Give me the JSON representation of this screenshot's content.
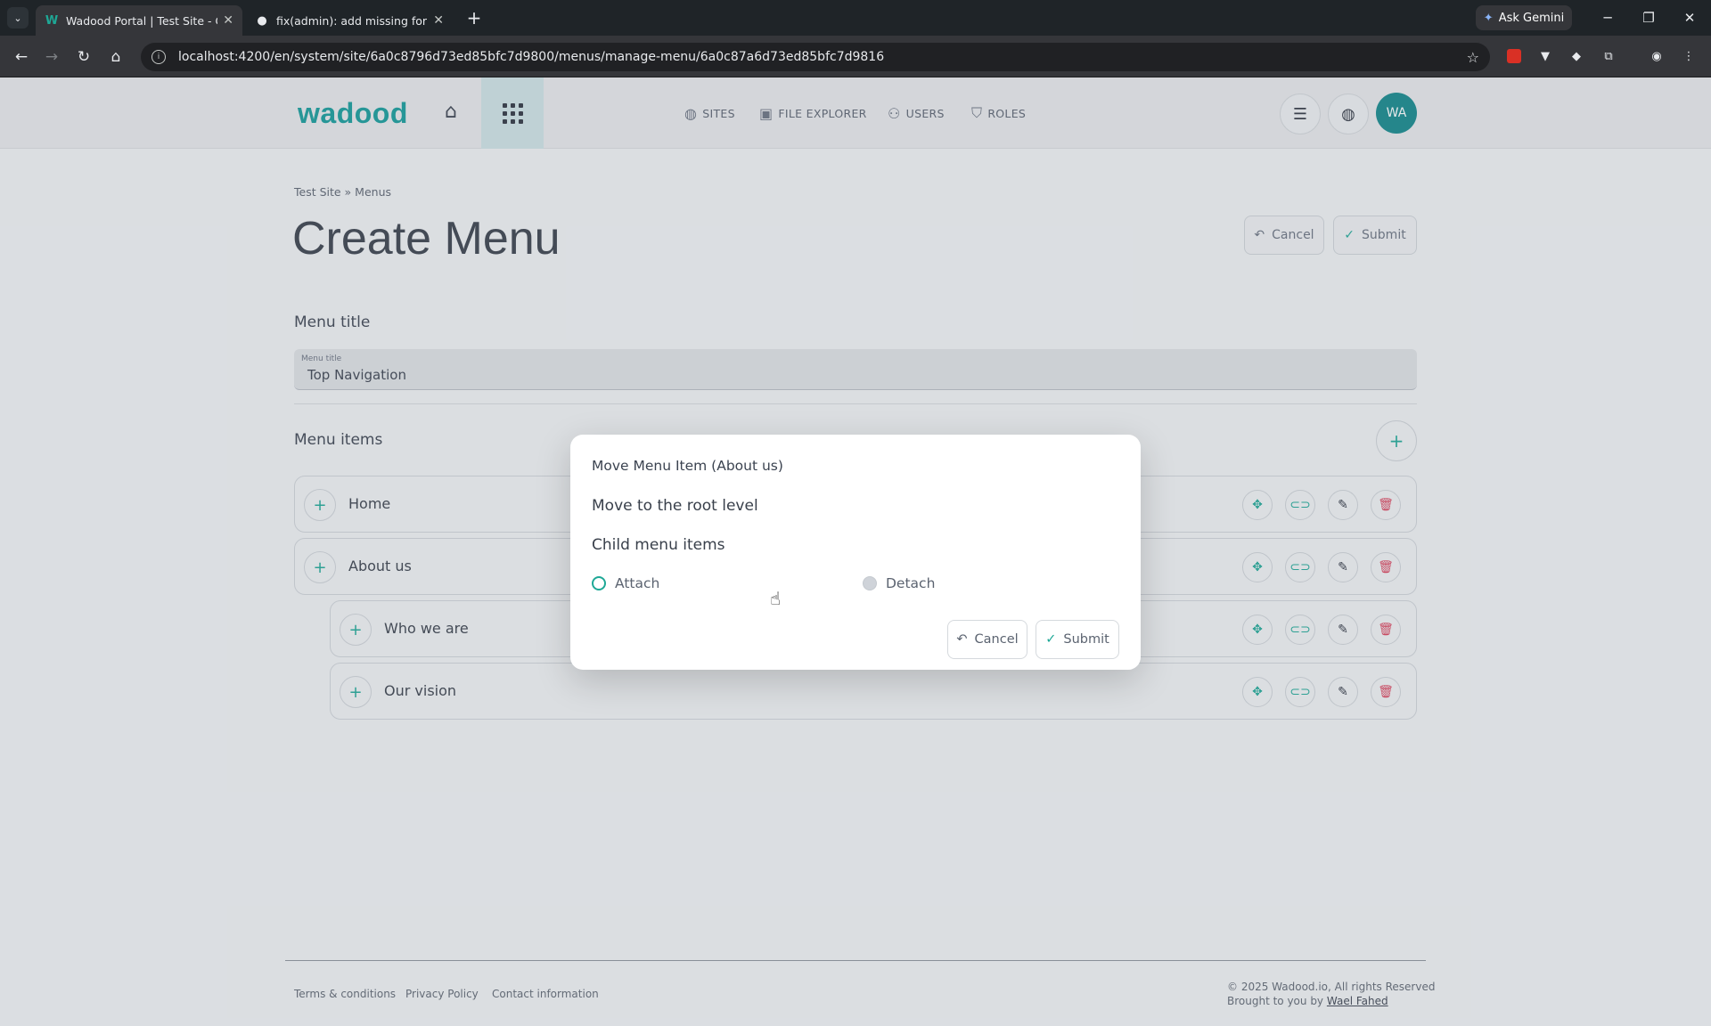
{
  "browser": {
    "tabs": [
      {
        "title": "Wadood Portal | Test Site - Crea",
        "active": true
      },
      {
        "title": "fix(admin): add missing form.va",
        "active": false
      }
    ],
    "url": "localhost:4200/en/system/site/6a0c8796d73ed85bfc7d9800/menus/manage-menu/6a0c87a6d73ed85bfc7d9816",
    "gemini_label": "Ask Gemini"
  },
  "header": {
    "logo": "wadood",
    "nav": [
      {
        "label": "SITES",
        "icon": "globe-icon"
      },
      {
        "label": "FILE EXPLORER",
        "icon": "image-stack-icon"
      },
      {
        "label": "USERS",
        "icon": "users-icon"
      },
      {
        "label": "ROLES",
        "icon": "shield-icon"
      }
    ],
    "avatar_initials": "WA"
  },
  "page": {
    "breadcrumb": "Test Site  » Menus",
    "title": "Create Menu",
    "cancel_label": "Cancel",
    "submit_label": "Submit",
    "menu_title_section": "Menu title",
    "menu_title_field_label": "Menu title",
    "menu_title_value": "Top Navigation",
    "menu_items_section": "Menu items",
    "menu_items": [
      {
        "label": "Home"
      },
      {
        "label": "About us"
      },
      {
        "label": "Who we are"
      },
      {
        "label": "Our vision"
      }
    ]
  },
  "modal": {
    "title": "Move Menu Item (About us)",
    "root_label": "Move to the root level",
    "child_label": "Child menu items",
    "options": [
      {
        "label": "Attach",
        "selected": false
      },
      {
        "label": "Detach",
        "selected": true
      }
    ],
    "cancel_label": "Cancel",
    "submit_label": "Submit"
  },
  "footer": {
    "links": [
      "Terms & conditions",
      "Privacy Policy",
      "Contact information"
    ],
    "copyright": "© 2025 Wadood.io, All rights Reserved",
    "brought_by": "Brought to you by",
    "author": "Wael Fahed"
  },
  "colors": {
    "accent": "#1ea896",
    "brand": "#149c9a",
    "danger": "#d9405a"
  }
}
